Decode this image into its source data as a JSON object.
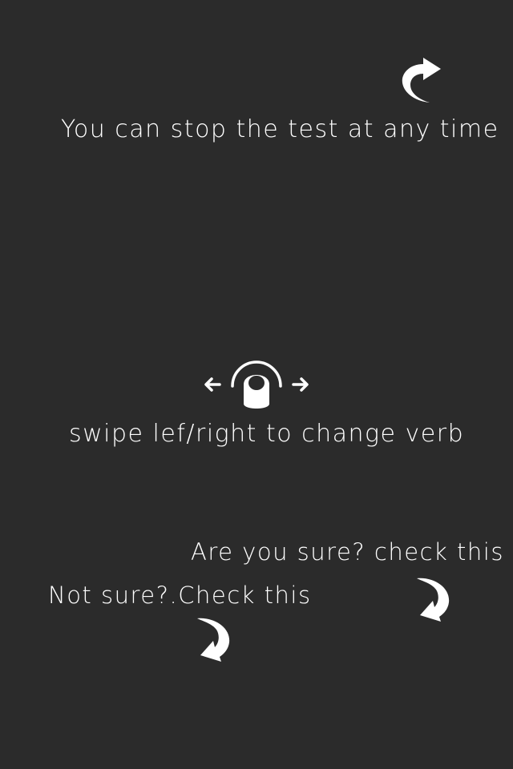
{
  "colors": {
    "background": "#2b2b2b",
    "foreground": "#ffffff"
  },
  "hints": {
    "stop": {
      "text": "You can stop the test at any time",
      "icon": "curved-arrow-up-right-icon"
    },
    "swipe": {
      "text": "swipe lef/right to change verb",
      "icon": "swipe-left-right-icon"
    },
    "are_you_sure": {
      "text": "Are you sure? check this",
      "icon": "curved-arrow-down-icon"
    },
    "not_sure": {
      "text": "Not sure?.Check this",
      "icon": "curved-arrow-down-icon"
    }
  }
}
